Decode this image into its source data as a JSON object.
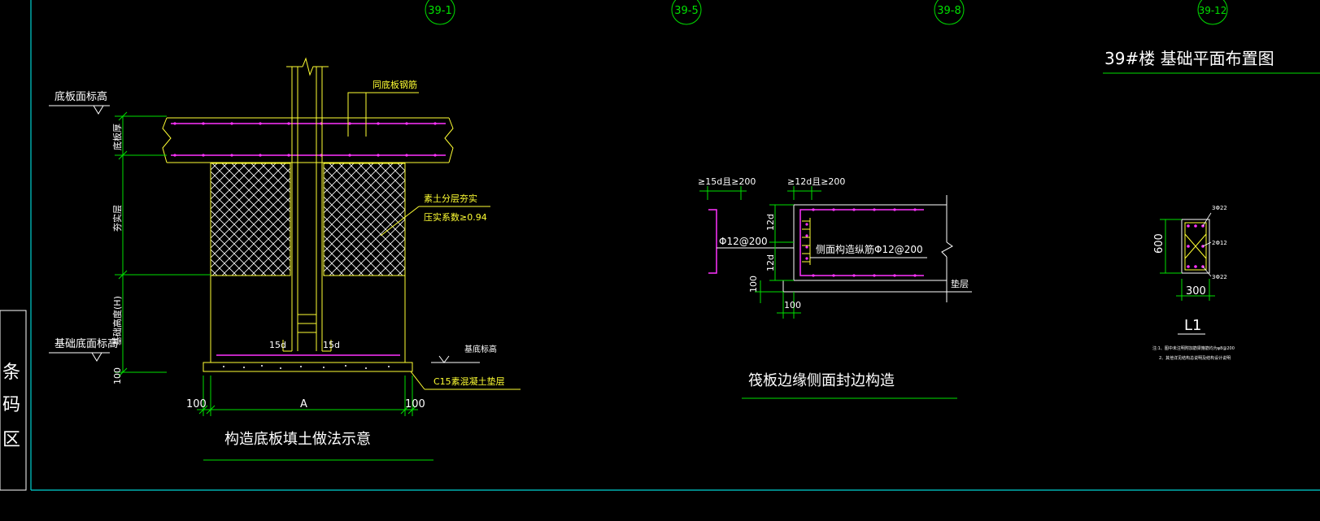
{
  "drawing": {
    "title": "39#楼 基础平面布置图",
    "grid_bubbles": [
      "39-1",
      "39-5",
      "39-8",
      "39-12"
    ],
    "left_panel_chars": [
      "条",
      "码",
      "区"
    ]
  },
  "detail1": {
    "caption": "构造底板填土做法示意",
    "top_level_label": "底板面标高",
    "slab_thk_label": "底板厚",
    "fill_thk_label": "夯实层",
    "found_height_label": "基础高度(H)",
    "bottom_level_label": "基础底面标高",
    "dim_100": "100",
    "bar_note": "同底板钢筋",
    "fill_note_1": "素土分层夯实",
    "fill_note_2": "压实系数≥0.94",
    "lap_left": "15d",
    "lap_right": "15d",
    "bed_level_label": "基底标高",
    "bed_note": "C15素混凝土垫层",
    "dim_left": "100",
    "dim_a": "A",
    "dim_right": "100"
  },
  "detail2": {
    "caption": "筏板边缘侧面封边构造",
    "dim_15d": "≥15d且≥200",
    "dim_12d": "≥12d且≥200",
    "bar_left": "Φ12@200",
    "side_bars": "侧面构造纵筋Φ12@200",
    "dim_12d_top": "12d",
    "dim_12d_bot": "12d",
    "dim_100_v": "100",
    "dim_100_h": "100",
    "bed_label": "垫层"
  },
  "detail3": {
    "beam_label": "L1",
    "height": "600",
    "width": "300",
    "bars_top": "3Φ22",
    "bars_mid": "2Φ12",
    "bars_bot": "3Φ22",
    "note_1": "注:1、图中未注明附加筋梁箍筋均为φ8@200",
    "note_2": "2、其他详见结构总说明及结构设计说明"
  },
  "colors": {
    "background": "#000000",
    "frame": "#00d2d2",
    "green": "#00e000",
    "yellow": "#ffff33",
    "white": "#ffffff",
    "magenta": "#ff33ff"
  }
}
